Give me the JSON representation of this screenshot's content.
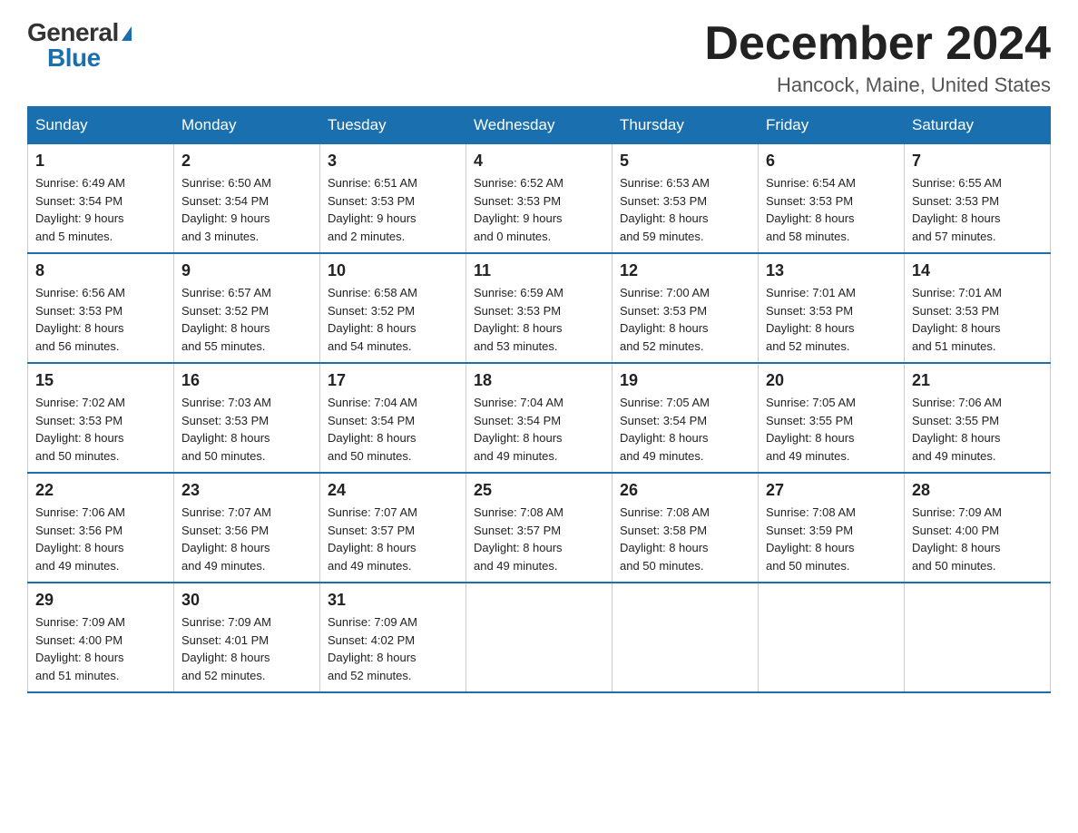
{
  "header": {
    "logo_general": "General",
    "logo_blue": "Blue",
    "month_title": "December 2024",
    "location": "Hancock, Maine, United States"
  },
  "weekdays": [
    "Sunday",
    "Monday",
    "Tuesday",
    "Wednesday",
    "Thursday",
    "Friday",
    "Saturday"
  ],
  "weeks": [
    [
      {
        "day": "1",
        "sunrise": "6:49 AM",
        "sunset": "3:54 PM",
        "daylight": "9 hours",
        "minutes": "and 5 minutes."
      },
      {
        "day": "2",
        "sunrise": "6:50 AM",
        "sunset": "3:54 PM",
        "daylight": "9 hours",
        "minutes": "and 3 minutes."
      },
      {
        "day": "3",
        "sunrise": "6:51 AM",
        "sunset": "3:53 PM",
        "daylight": "9 hours",
        "minutes": "and 2 minutes."
      },
      {
        "day": "4",
        "sunrise": "6:52 AM",
        "sunset": "3:53 PM",
        "daylight": "9 hours",
        "minutes": "and 0 minutes."
      },
      {
        "day": "5",
        "sunrise": "6:53 AM",
        "sunset": "3:53 PM",
        "daylight": "8 hours",
        "minutes": "and 59 minutes."
      },
      {
        "day": "6",
        "sunrise": "6:54 AM",
        "sunset": "3:53 PM",
        "daylight": "8 hours",
        "minutes": "and 58 minutes."
      },
      {
        "day": "7",
        "sunrise": "6:55 AM",
        "sunset": "3:53 PM",
        "daylight": "8 hours",
        "minutes": "and 57 minutes."
      }
    ],
    [
      {
        "day": "8",
        "sunrise": "6:56 AM",
        "sunset": "3:53 PM",
        "daylight": "8 hours",
        "minutes": "and 56 minutes."
      },
      {
        "day": "9",
        "sunrise": "6:57 AM",
        "sunset": "3:52 PM",
        "daylight": "8 hours",
        "minutes": "and 55 minutes."
      },
      {
        "day": "10",
        "sunrise": "6:58 AM",
        "sunset": "3:52 PM",
        "daylight": "8 hours",
        "minutes": "and 54 minutes."
      },
      {
        "day": "11",
        "sunrise": "6:59 AM",
        "sunset": "3:53 PM",
        "daylight": "8 hours",
        "minutes": "and 53 minutes."
      },
      {
        "day": "12",
        "sunrise": "7:00 AM",
        "sunset": "3:53 PM",
        "daylight": "8 hours",
        "minutes": "and 52 minutes."
      },
      {
        "day": "13",
        "sunrise": "7:01 AM",
        "sunset": "3:53 PM",
        "daylight": "8 hours",
        "minutes": "and 52 minutes."
      },
      {
        "day": "14",
        "sunrise": "7:01 AM",
        "sunset": "3:53 PM",
        "daylight": "8 hours",
        "minutes": "and 51 minutes."
      }
    ],
    [
      {
        "day": "15",
        "sunrise": "7:02 AM",
        "sunset": "3:53 PM",
        "daylight": "8 hours",
        "minutes": "and 50 minutes."
      },
      {
        "day": "16",
        "sunrise": "7:03 AM",
        "sunset": "3:53 PM",
        "daylight": "8 hours",
        "minutes": "and 50 minutes."
      },
      {
        "day": "17",
        "sunrise": "7:04 AM",
        "sunset": "3:54 PM",
        "daylight": "8 hours",
        "minutes": "and 50 minutes."
      },
      {
        "day": "18",
        "sunrise": "7:04 AM",
        "sunset": "3:54 PM",
        "daylight": "8 hours",
        "minutes": "and 49 minutes."
      },
      {
        "day": "19",
        "sunrise": "7:05 AM",
        "sunset": "3:54 PM",
        "daylight": "8 hours",
        "minutes": "and 49 minutes."
      },
      {
        "day": "20",
        "sunrise": "7:05 AM",
        "sunset": "3:55 PM",
        "daylight": "8 hours",
        "minutes": "and 49 minutes."
      },
      {
        "day": "21",
        "sunrise": "7:06 AM",
        "sunset": "3:55 PM",
        "daylight": "8 hours",
        "minutes": "and 49 minutes."
      }
    ],
    [
      {
        "day": "22",
        "sunrise": "7:06 AM",
        "sunset": "3:56 PM",
        "daylight": "8 hours",
        "minutes": "and 49 minutes."
      },
      {
        "day": "23",
        "sunrise": "7:07 AM",
        "sunset": "3:56 PM",
        "daylight": "8 hours",
        "minutes": "and 49 minutes."
      },
      {
        "day": "24",
        "sunrise": "7:07 AM",
        "sunset": "3:57 PM",
        "daylight": "8 hours",
        "minutes": "and 49 minutes."
      },
      {
        "day": "25",
        "sunrise": "7:08 AM",
        "sunset": "3:57 PM",
        "daylight": "8 hours",
        "minutes": "and 49 minutes."
      },
      {
        "day": "26",
        "sunrise": "7:08 AM",
        "sunset": "3:58 PM",
        "daylight": "8 hours",
        "minutes": "and 50 minutes."
      },
      {
        "day": "27",
        "sunrise": "7:08 AM",
        "sunset": "3:59 PM",
        "daylight": "8 hours",
        "minutes": "and 50 minutes."
      },
      {
        "day": "28",
        "sunrise": "7:09 AM",
        "sunset": "4:00 PM",
        "daylight": "8 hours",
        "minutes": "and 50 minutes."
      }
    ],
    [
      {
        "day": "29",
        "sunrise": "7:09 AM",
        "sunset": "4:00 PM",
        "daylight": "8 hours",
        "minutes": "and 51 minutes."
      },
      {
        "day": "30",
        "sunrise": "7:09 AM",
        "sunset": "4:01 PM",
        "daylight": "8 hours",
        "minutes": "and 52 minutes."
      },
      {
        "day": "31",
        "sunrise": "7:09 AM",
        "sunset": "4:02 PM",
        "daylight": "8 hours",
        "minutes": "and 52 minutes."
      },
      null,
      null,
      null,
      null
    ]
  ],
  "labels": {
    "sunrise": "Sunrise:",
    "sunset": "Sunset:",
    "daylight": "Daylight:"
  }
}
